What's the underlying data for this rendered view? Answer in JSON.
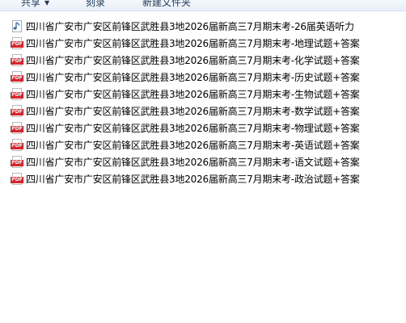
{
  "toolbar": {
    "share_label": "共享",
    "burn_label": "刻录",
    "new_folder_label": "新建文件夹"
  },
  "files": [
    {
      "name": "四川省广安市广安区前锋区武胜县3地2026届新高三7月期末考-26届英语听力",
      "icon": "audio-file-icon",
      "icon_label": ""
    },
    {
      "name": "四川省广安市广安区前锋区武胜县3地2026届新高三7月期末考-地理试题+答案",
      "icon": "pdf-file-icon",
      "icon_label": "PDF"
    },
    {
      "name": "四川省广安市广安区前锋区武胜县3地2026届新高三7月期末考-化学试题+答案",
      "icon": "pdf-file-icon",
      "icon_label": "PDF"
    },
    {
      "name": "四川省广安市广安区前锋区武胜县3地2026届新高三7月期末考-历史试题+答案",
      "icon": "pdf-file-icon",
      "icon_label": "PDF"
    },
    {
      "name": "四川省广安市广安区前锋区武胜县3地2026届新高三7月期末考-生物试题+答案",
      "icon": "pdf-file-icon",
      "icon_label": "PDF"
    },
    {
      "name": "四川省广安市广安区前锋区武胜县3地2026届新高三7月期末考-数学试题+答案",
      "icon": "pdf-file-icon",
      "icon_label": "PDF"
    },
    {
      "name": "四川省广安市广安区前锋区武胜县3地2026届新高三7月期末考-物理试题+答案",
      "icon": "pdf-file-icon",
      "icon_label": "PDF"
    },
    {
      "name": "四川省广安市广安区前锋区武胜县3地2026届新高三7月期末考-英语试题+答案",
      "icon": "pdf-file-icon",
      "icon_label": "PDF"
    },
    {
      "name": "四川省广安市广安区前锋区武胜县3地2026届新高三7月期末考-语文试题+答案",
      "icon": "pdf-file-icon",
      "icon_label": "PDF"
    },
    {
      "name": "四川省广安市广安区前锋区武胜县3地2026届新高三7月期末考-政治试题+答案",
      "icon": "pdf-file-icon",
      "icon_label": "PDF"
    }
  ]
}
